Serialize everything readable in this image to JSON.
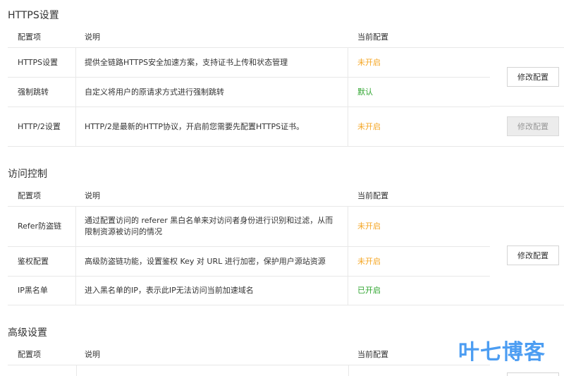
{
  "headers": {
    "name": "配置项",
    "desc": "说明",
    "value": "当前配置"
  },
  "sections": [
    {
      "title": "HTTPS设置",
      "rows": [
        {
          "name": "HTTPS设置",
          "desc": "提供全链路HTTPS安全加速方案，支持证书上传和状态管理",
          "value": "未开启",
          "status": "orange"
        },
        {
          "name": "强制跳转",
          "desc": "自定义将用户的原请求方式进行强制跳转",
          "value": "默认",
          "status": "green"
        },
        {
          "name": "HTTP/2设置",
          "desc": "HTTP/2是最新的HTTP协议，开启前您需要先配置HTTPS证书。",
          "value": "未开启",
          "status": "orange"
        }
      ],
      "buttons": [
        "修改配置",
        "修改配置"
      ]
    },
    {
      "title": "访问控制",
      "rows": [
        {
          "name": "Refer防盗链",
          "desc": "通过配置访问的 referer 黑白名单来对访问者身份进行识别和过滤，从而限制资源被访问的情况",
          "value": "未开启",
          "status": "orange"
        },
        {
          "name": "鉴权配置",
          "desc": "高级防盗链功能，设置鉴权 Key 对 URL 进行加密，保护用户源站资源",
          "value": "未开启",
          "status": "orange"
        },
        {
          "name": "IP黑名单",
          "desc": "进入黑名单的IP，表示此IP无法访问当前加速域名",
          "value": "已开启",
          "status": "green"
        }
      ],
      "buttons": [
        "修改配置"
      ]
    },
    {
      "title": "高级设置",
      "rows": []
    }
  ],
  "watermark": "叶七博客"
}
